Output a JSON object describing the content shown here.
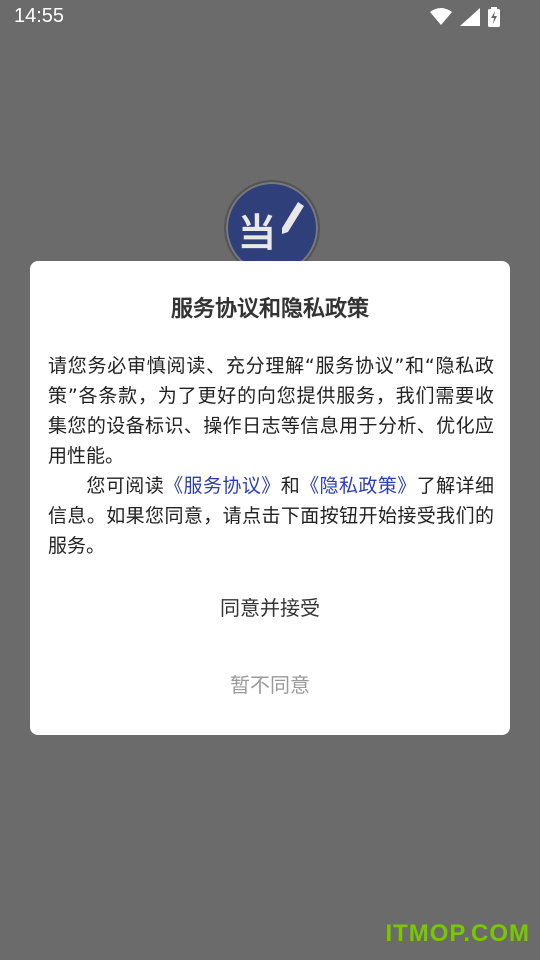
{
  "status_bar": {
    "time": "14:55",
    "icons": [
      "wifi-icon",
      "signal-icon",
      "battery-charging-icon"
    ]
  },
  "app_logo": {
    "glyph": "当"
  },
  "dialog": {
    "title": "服务协议和隐私政策",
    "paragraph1": "请您务必审慎阅读、充分理解“服务协议”和“隐私政策”各条款，为了更好的向您提供服务，我们需要收集您的设备标识、操作日志等信息用于分析、优化应用性能。",
    "paragraph2_prefix": "您可阅读",
    "service_agreement_link": "《服务协议》",
    "and_text": "和",
    "privacy_policy_link": "《隐私政策》",
    "paragraph2_suffix": "了解详细信息。如果您同意，请点击下面按钮开始接受我们的服务。",
    "agree_label": "同意并接受",
    "decline_label": "暂不同意"
  },
  "watermark": {
    "text": "ITMOP.COM"
  },
  "colors": {
    "overlay": "#6b6b6b",
    "link": "#2b3fb0",
    "decline_text": "#9a9a9a",
    "watermark": "#78c800"
  }
}
